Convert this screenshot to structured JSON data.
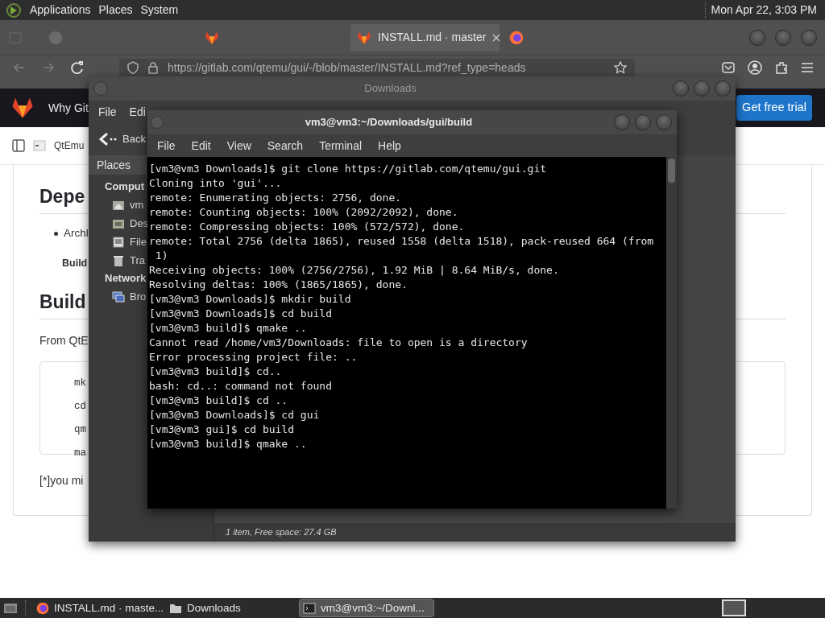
{
  "top_panel": {
    "menus": [
      "Applications",
      "Places",
      "System"
    ],
    "clock": "Mon Apr 22, 3:03 PM"
  },
  "browser": {
    "tabs": [
      {
        "selected": false
      },
      {
        "selected": false
      },
      {
        "label": "INSTALL.md · master",
        "selected": true
      },
      {
        "selected": false
      }
    ],
    "url": "https://gitlab.com/qtemu/gui/-/blob/master/INSTALL.md?ref_type=heads",
    "site_nav": "Why Git",
    "trial_button": "Get free trial",
    "breadcrumb": "QtEmu",
    "page": [
      {
        "kind": "h2",
        "text": "Depe"
      },
      {
        "kind": "bullet",
        "text": "Archl"
      },
      {
        "kind": "bold",
        "text": "Build"
      },
      {
        "kind": "h2",
        "text": "Build"
      },
      {
        "kind": "p",
        "text": "From QtE"
      },
      {
        "kind": "code",
        "lines": [
          "mk",
          "cd",
          "qm",
          "ma"
        ]
      },
      {
        "kind": "p",
        "text": "[*]you mi"
      }
    ]
  },
  "file_manager": {
    "title": "Downloads",
    "menus": [
      "File",
      "Edi"
    ],
    "back": "Back",
    "places": "Places",
    "sidebar": [
      {
        "kind": "header",
        "text": "Comput"
      },
      {
        "kind": "item",
        "text": "vm"
      },
      {
        "kind": "item",
        "text": "Des"
      },
      {
        "kind": "item",
        "text": "File"
      },
      {
        "kind": "item",
        "text": "Tra"
      },
      {
        "kind": "header",
        "text": "Network"
      },
      {
        "kind": "item",
        "text": "Bro"
      }
    ],
    "status": "1 item, Free space: 27.4 GB"
  },
  "terminal": {
    "title": "vm3@vm3:~/Downloads/gui/build",
    "menus": [
      "File",
      "Edit",
      "View",
      "Search",
      "Terminal",
      "Help"
    ],
    "lines": [
      "[vm3@vm3 Downloads]$ git clone https://gitlab.com/qtemu/gui.git",
      "Cloning into 'gui'...",
      "remote: Enumerating objects: 2756, done.",
      "remote: Counting objects: 100% (2092/2092), done.",
      "remote: Compressing objects: 100% (572/572), done.",
      "remote: Total 2756 (delta 1865), reused 1558 (delta 1518), pack-reused 664 (from",
      " 1)",
      "Receiving objects: 100% (2756/2756), 1.92 MiB | 8.64 MiB/s, done.",
      "Resolving deltas: 100% (1865/1865), done.",
      "[vm3@vm3 Downloads]$ mkdir build",
      "[vm3@vm3 Downloads]$ cd build",
      "[vm3@vm3 build]$ qmake ..",
      "Cannot read /home/vm3/Downloads: file to open is a directory",
      "Error processing project file: ..",
      "[vm3@vm3 build]$ cd..",
      "bash: cd..: command not found",
      "[vm3@vm3 build]$ cd ..",
      "[vm3@vm3 Downloads]$ cd gui",
      "[vm3@vm3 gui]$ cd build",
      "[vm3@vm3 build]$ qmake .."
    ]
  },
  "taskbar": [
    {
      "label": "INSTALL.md · maste...",
      "selected": false
    },
    {
      "label": "Downloads",
      "selected": false
    },
    {
      "label": "vm3@vm3:~/Downl...",
      "selected": true
    }
  ]
}
